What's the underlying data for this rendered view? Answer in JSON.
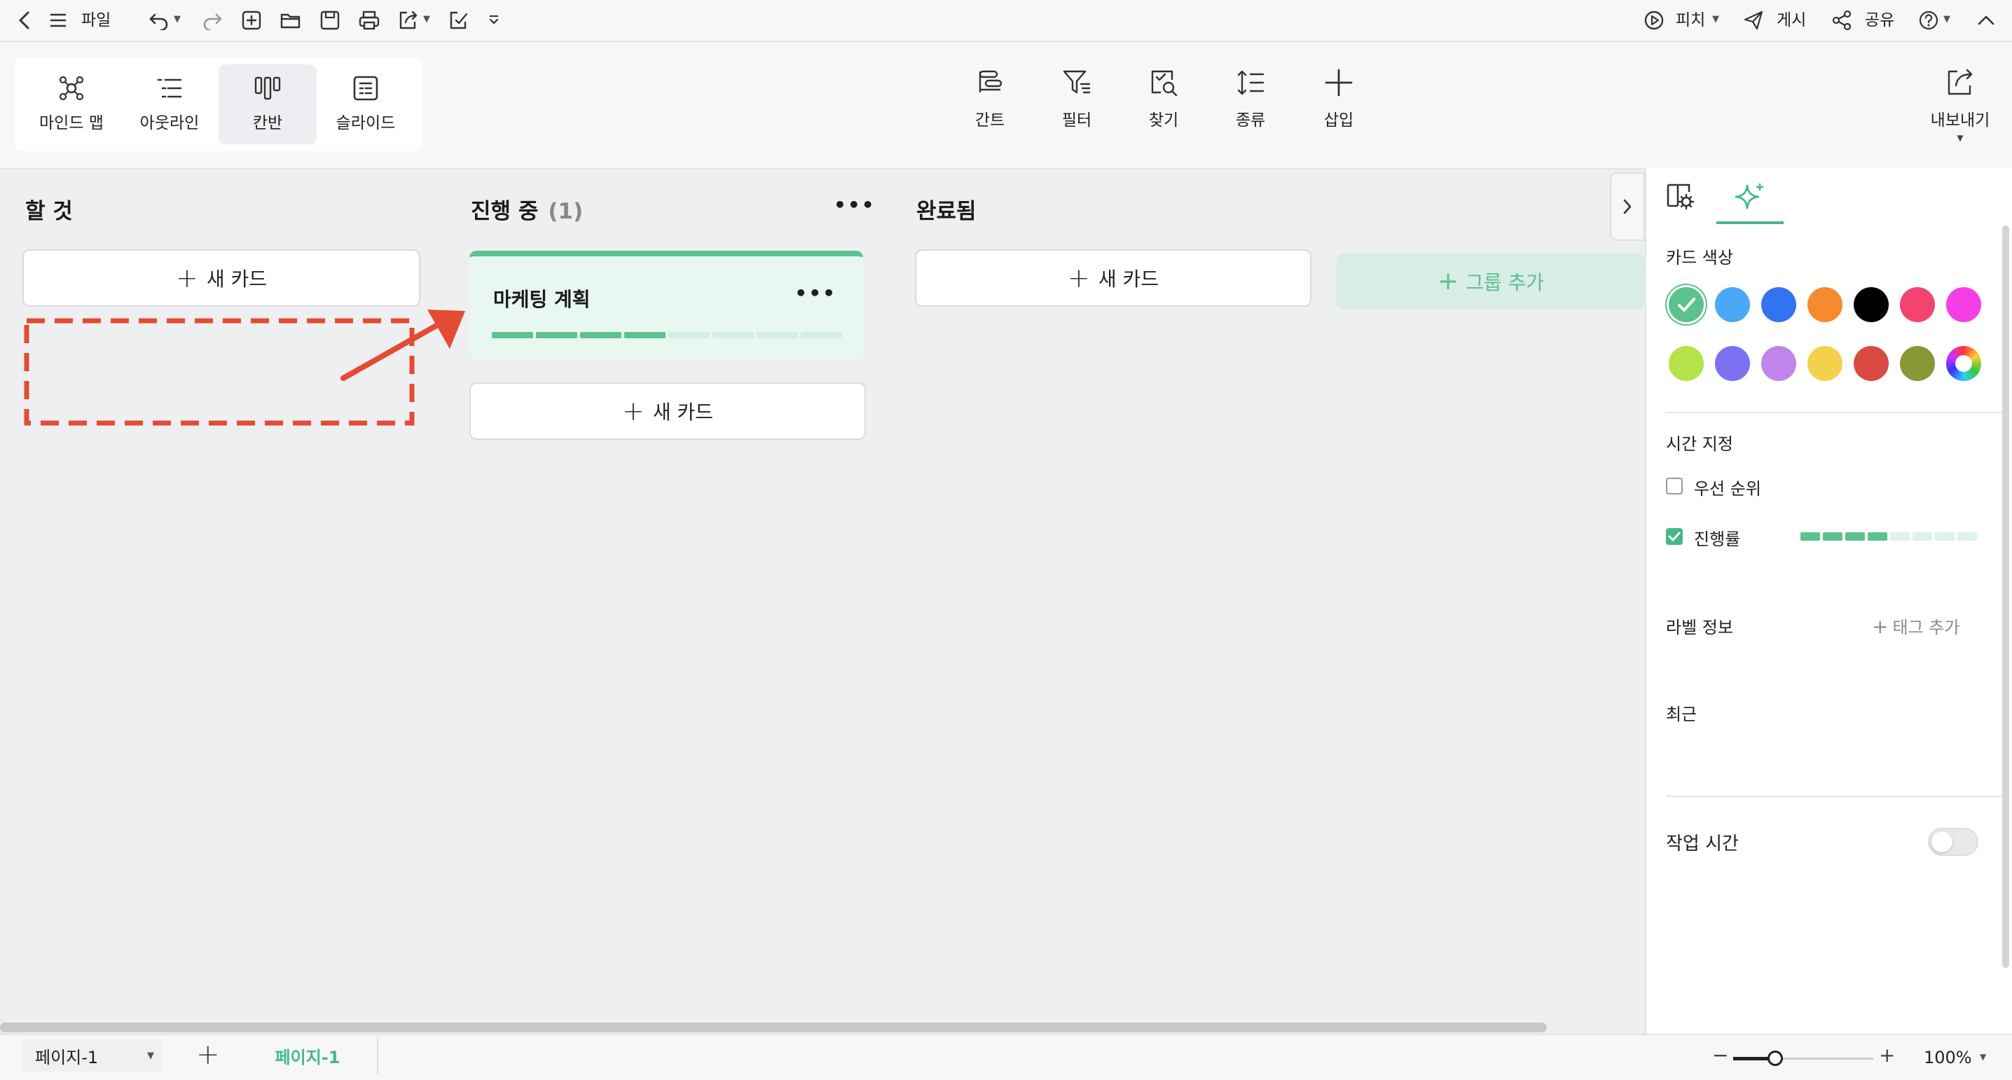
{
  "topbar": {
    "file_label": "파일",
    "pitch_label": "피치",
    "post_label": "게시",
    "share_label": "공유"
  },
  "views": {
    "mindmap": "마인드 맵",
    "outline": "아웃라인",
    "kanban": "칸반",
    "slide": "슬라이드",
    "active": "kanban"
  },
  "tools": {
    "gantt": "간트",
    "filter": "필터",
    "find": "찾기",
    "sort": "종류",
    "insert": "삽입",
    "export": "내보내기"
  },
  "board": {
    "columns": [
      {
        "title": "할 것",
        "count": "",
        "new_card": "새 카드"
      },
      {
        "title": "진행 중",
        "count": "(1)",
        "new_card": "새 카드"
      },
      {
        "title": "완료됨",
        "count": "",
        "new_card": "새 카드"
      }
    ],
    "cards": [
      {
        "title": "마케팅 계획",
        "progress_filled": 4,
        "progress_total": 8,
        "color": "#5cc28f"
      }
    ],
    "add_group": "그룹 추가"
  },
  "panel": {
    "card_color_label": "카드 색상",
    "colors": [
      "#5cc28f",
      "#4aa8f7",
      "#3273f1",
      "#f68a2e",
      "#000000",
      "#f5436f",
      "#f53ee6",
      "#b4e24a",
      "#7b71f2",
      "#c184ea",
      "#f4d14b",
      "#d84a42",
      "#8a9735",
      "rainbow"
    ],
    "selected_color": "#5cc28f",
    "time_label": "시간 지정",
    "priority_label": "우선 순위",
    "priority_checked": false,
    "progress_label": "진행률",
    "progress_checked": true,
    "progress_filled": 4,
    "progress_total": 8,
    "label_info": "라벨 정보",
    "add_tag": "태그 추가",
    "recent": "최근",
    "work_time": "작업 시간",
    "work_time_on": false
  },
  "bottom": {
    "page_select": "페이지-1",
    "page_tab": "페이지-1",
    "zoom": "100%",
    "zoom_level": 0.3
  },
  "accent": "#5cc28f",
  "annotation_color": "#e54a32"
}
